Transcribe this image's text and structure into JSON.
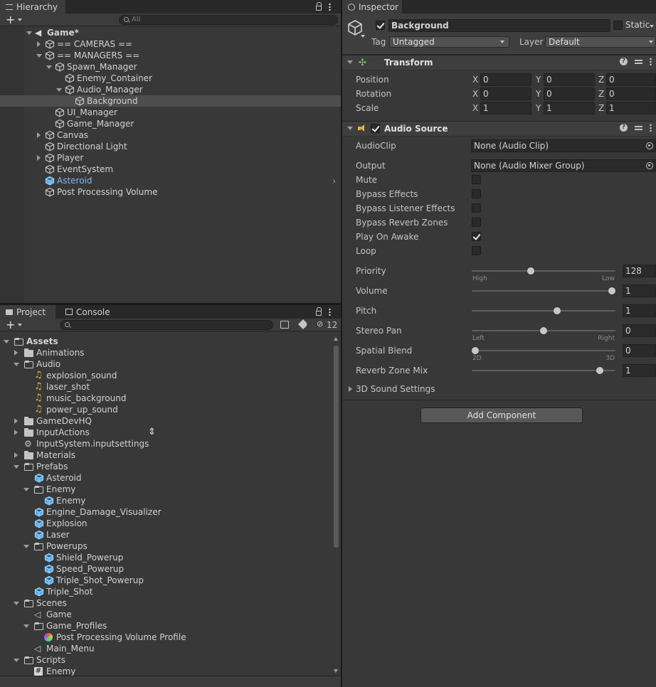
{
  "hierarchy": {
    "tab_label": "Hierarchy",
    "search_placeholder": "All",
    "items": [
      {
        "label": "Game*",
        "depth": 0,
        "expand": "down",
        "icon": "unity-scene-icon",
        "bold": true
      },
      {
        "label": "== CAMERAS ==",
        "depth": 1,
        "expand": "right",
        "icon": "gameobject-cube-icon"
      },
      {
        "label": "== MANAGERS ==",
        "depth": 1,
        "expand": "down",
        "icon": "gameobject-cube-icon"
      },
      {
        "label": "Spawn_Manager",
        "depth": 2,
        "expand": "down",
        "icon": "gameobject-cube-icon"
      },
      {
        "label": "Enemy_Container",
        "depth": 3,
        "expand": "none",
        "icon": "gameobject-cube-icon"
      },
      {
        "label": "Audio_Manager",
        "depth": 3,
        "expand": "down",
        "icon": "gameobject-cube-icon"
      },
      {
        "label": "Background",
        "depth": 4,
        "expand": "none",
        "icon": "gameobject-cube-icon",
        "selected": true
      },
      {
        "label": "UI_Manager",
        "depth": 2,
        "expand": "none",
        "icon": "gameobject-cube-icon"
      },
      {
        "label": "Game_Manager",
        "depth": 2,
        "expand": "none",
        "icon": "gameobject-cube-icon"
      },
      {
        "label": "Canvas",
        "depth": 1,
        "expand": "right",
        "icon": "gameobject-cube-icon"
      },
      {
        "label": "Directional Light",
        "depth": 1,
        "expand": "none",
        "icon": "gameobject-cube-icon"
      },
      {
        "label": "Player",
        "depth": 1,
        "expand": "right",
        "icon": "gameobject-cube-icon"
      },
      {
        "label": "EventSystem",
        "depth": 1,
        "expand": "none",
        "icon": "gameobject-cube-icon"
      },
      {
        "label": "Asteroid",
        "depth": 1,
        "expand": "none",
        "icon": "prefab-cube-icon",
        "prefab": true
      },
      {
        "label": "Post Processing Volume",
        "depth": 1,
        "expand": "none",
        "icon": "gameobject-cube-icon"
      }
    ]
  },
  "project": {
    "tab_project": "Project",
    "tab_console": "Console",
    "hidden_count": "12",
    "items": [
      {
        "label": "Assets",
        "depth": 0,
        "expand": "down",
        "icon": "folder-open-icon",
        "bold": true
      },
      {
        "label": "Animations",
        "depth": 1,
        "expand": "right",
        "icon": "folder-icon"
      },
      {
        "label": "Audio",
        "depth": 1,
        "expand": "down",
        "icon": "folder-open-icon"
      },
      {
        "label": "explosion_sound",
        "depth": 2,
        "expand": "none",
        "icon": "audio-clip-icon"
      },
      {
        "label": "laser_shot",
        "depth": 2,
        "expand": "none",
        "icon": "audio-clip-icon"
      },
      {
        "label": "music_background",
        "depth": 2,
        "expand": "none",
        "icon": "audio-clip-icon"
      },
      {
        "label": "power_up_sound",
        "depth": 2,
        "expand": "none",
        "icon": "audio-clip-icon"
      },
      {
        "label": "GameDevHQ",
        "depth": 1,
        "expand": "right",
        "icon": "folder-icon"
      },
      {
        "label": "InputActions",
        "depth": 1,
        "expand": "right",
        "icon": "folder-icon"
      },
      {
        "label": "InputSystem.inputsettings",
        "depth": 1,
        "expand": "none",
        "icon": "input-settings-icon"
      },
      {
        "label": "Materials",
        "depth": 1,
        "expand": "right",
        "icon": "folder-icon"
      },
      {
        "label": "Prefabs",
        "depth": 1,
        "expand": "down",
        "icon": "folder-open-icon"
      },
      {
        "label": "Asteroid",
        "depth": 2,
        "expand": "none",
        "icon": "prefab-cube-icon"
      },
      {
        "label": "Enemy",
        "depth": 2,
        "expand": "down",
        "icon": "folder-open-icon"
      },
      {
        "label": "Enemy",
        "depth": 3,
        "expand": "none",
        "icon": "prefab-cube-icon"
      },
      {
        "label": "Engine_Damage_Visualizer",
        "depth": 2,
        "expand": "none",
        "icon": "prefab-cube-icon"
      },
      {
        "label": "Explosion",
        "depth": 2,
        "expand": "none",
        "icon": "prefab-cube-icon"
      },
      {
        "label": "Laser",
        "depth": 2,
        "expand": "none",
        "icon": "prefab-cube-icon"
      },
      {
        "label": "Powerups",
        "depth": 2,
        "expand": "down",
        "icon": "folder-open-icon"
      },
      {
        "label": "Shield_Powerup",
        "depth": 3,
        "expand": "none",
        "icon": "prefab-cube-icon"
      },
      {
        "label": "Speed_Powerup",
        "depth": 3,
        "expand": "none",
        "icon": "prefab-cube-icon"
      },
      {
        "label": "Triple_Shot_Powerup",
        "depth": 3,
        "expand": "none",
        "icon": "prefab-cube-icon"
      },
      {
        "label": "Triple_Shot",
        "depth": 2,
        "expand": "none",
        "icon": "prefab-cube-icon"
      },
      {
        "label": "Scenes",
        "depth": 1,
        "expand": "down",
        "icon": "folder-open-icon"
      },
      {
        "label": "Game",
        "depth": 2,
        "expand": "none",
        "icon": "scene-icon"
      },
      {
        "label": "Game_Profiles",
        "depth": 2,
        "expand": "down",
        "icon": "folder-open-icon"
      },
      {
        "label": "Post Processing Volume Profile",
        "depth": 3,
        "expand": "none",
        "icon": "postprocess-profile-icon"
      },
      {
        "label": "Main_Menu",
        "depth": 2,
        "expand": "none",
        "icon": "scene-icon"
      },
      {
        "label": "Scripts",
        "depth": 1,
        "expand": "down",
        "icon": "folder-open-icon"
      },
      {
        "label": "Enemy",
        "depth": 2,
        "expand": "none",
        "icon": "script-icon"
      }
    ]
  },
  "inspector": {
    "tab_label": "Inspector",
    "object_name": "Background",
    "active": true,
    "static_label": "Static",
    "tag_label": "Tag",
    "tag_value": "Untagged",
    "layer_label": "Layer",
    "layer_value": "Default",
    "transform": {
      "title": "Transform",
      "rows": [
        {
          "label": "Position",
          "x": "0",
          "y": "0",
          "z": "0"
        },
        {
          "label": "Rotation",
          "x": "0",
          "y": "0",
          "z": "0"
        },
        {
          "label": "Scale",
          "x": "1",
          "y": "1",
          "z": "1"
        }
      ],
      "axis_x": "X",
      "axis_y": "Y",
      "axis_z": "Z"
    },
    "audio_source": {
      "title": "Audio Source",
      "enabled": true,
      "audioclip_label": "AudioClip",
      "audioclip_value": "None (Audio Clip)",
      "output_label": "Output",
      "output_value": "None (Audio Mixer Group)",
      "toggles": [
        {
          "label": "Mute",
          "checked": false
        },
        {
          "label": "Bypass Effects",
          "checked": false
        },
        {
          "label": "Bypass Listener Effects",
          "checked": false
        },
        {
          "label": "Bypass Reverb Zones",
          "checked": false
        },
        {
          "label": "Play On Awake",
          "checked": true
        },
        {
          "label": "Loop",
          "checked": false
        }
      ],
      "sliders": [
        {
          "label": "Priority",
          "value": "128",
          "fraction": 0.406,
          "left": "High",
          "right": "Low"
        },
        {
          "label": "Volume",
          "value": "1",
          "fraction": 1.0
        },
        {
          "label": "Pitch",
          "value": "1",
          "fraction": 0.6
        },
        {
          "label": "Stereo Pan",
          "value": "0",
          "fraction": 0.5,
          "left": "Left",
          "right": "Right"
        },
        {
          "label": "Spatial Blend",
          "value": "0",
          "fraction": 0.0,
          "left": "2D",
          "right": "3D"
        },
        {
          "label": "Reverb Zone Mix",
          "value": "1",
          "fraction": 0.909
        }
      ],
      "sound_settings_label": "3D Sound Settings"
    },
    "add_component_label": "Add Component"
  }
}
